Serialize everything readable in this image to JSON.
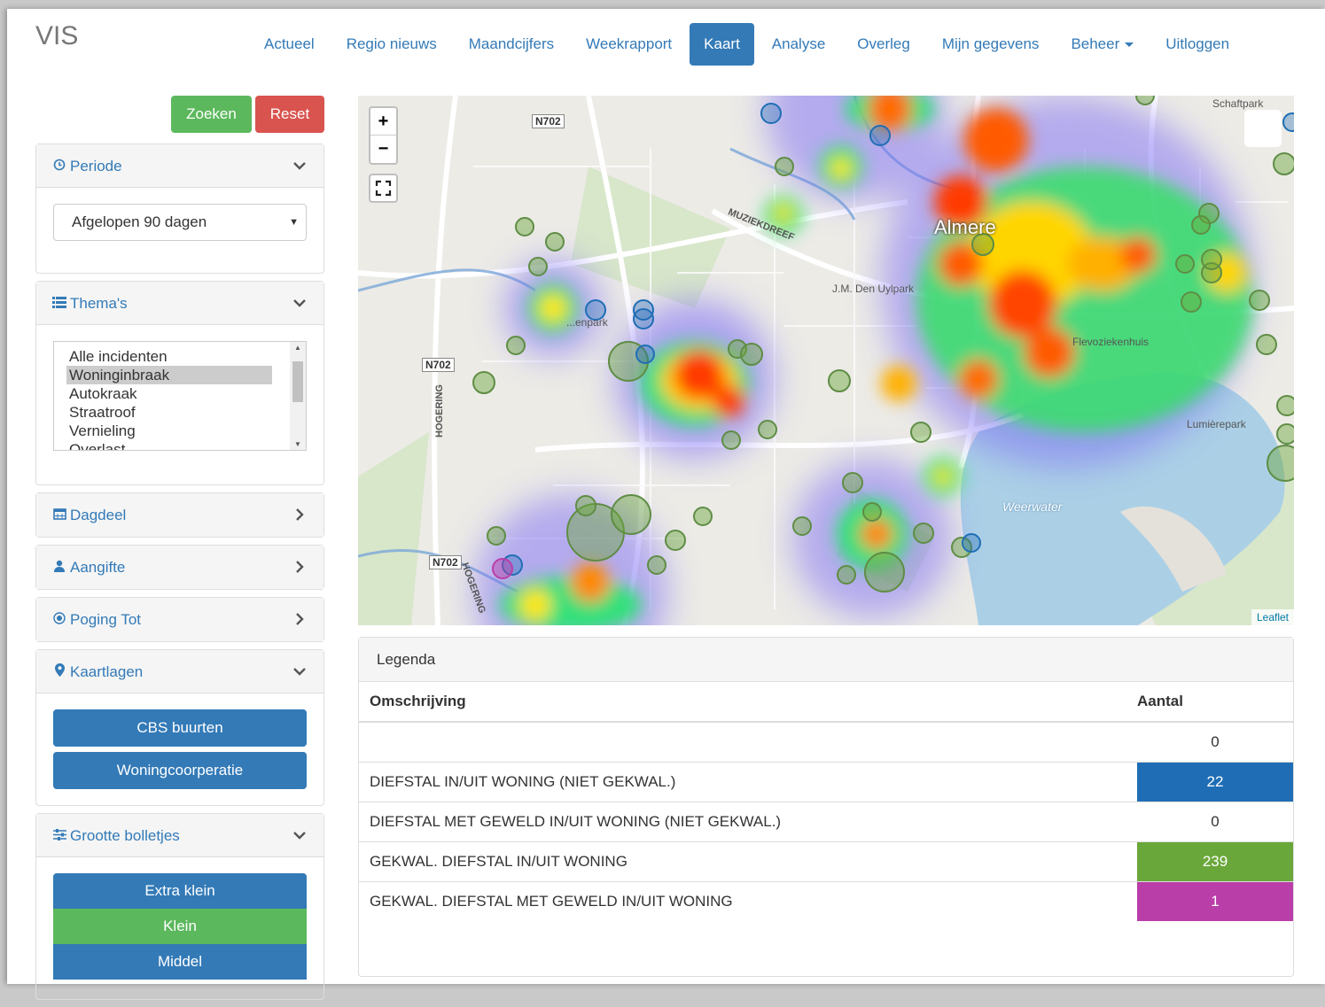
{
  "brand": "VIS",
  "nav": [
    {
      "label": "Actueel"
    },
    {
      "label": "Regio nieuws"
    },
    {
      "label": "Maandcijfers"
    },
    {
      "label": "Weekrapport"
    },
    {
      "label": "Kaart",
      "active": true
    },
    {
      "label": "Analyse"
    },
    {
      "label": "Overleg"
    },
    {
      "label": "Mijn gegevens"
    },
    {
      "label": "Beheer",
      "dropdown": true
    },
    {
      "label": "Uitloggen"
    }
  ],
  "sidebar": {
    "search_label": "Zoeken",
    "reset_label": "Reset",
    "periode": {
      "title": "Periode",
      "icon": "clock-icon",
      "select_value": "Afgelopen 90 dagen"
    },
    "themas": {
      "title": "Thema's",
      "icon": "list-icon",
      "options": [
        "Alle incidenten",
        "Woninginbraak",
        "Autokraak",
        "Straatroof",
        "Vernieling",
        "Overlast"
      ],
      "selected": "Woninginbraak"
    },
    "dagdeel": {
      "title": "Dagdeel",
      "icon": "calendar-icon"
    },
    "aangifte": {
      "title": "Aangifte",
      "icon": "user-icon"
    },
    "poging": {
      "title": "Poging Tot",
      "icon": "target-icon"
    },
    "kaartlagen": {
      "title": "Kaartlagen",
      "icon": "map-marker-icon",
      "buttons": [
        "CBS buurten",
        "Woningcoorperatie"
      ]
    },
    "grootte": {
      "title": "Grootte bolletjes",
      "icon": "sliders-icon",
      "options": [
        "Extra klein",
        "Klein",
        "Middel"
      ],
      "selected": "Klein"
    }
  },
  "map": {
    "zoom_in": "+",
    "zoom_out": "−",
    "attribution": "Leaflet",
    "labels": {
      "city": "Almere",
      "muziekdreef": "MUZIEKDREEF",
      "uylpark": "J.M. Den Uylpark",
      "park_left": "...enpark",
      "ziekenhuis": "Flevoziekenhuis",
      "lumierepark": "Lumièrepark",
      "weerwater": "Weerwater",
      "schaftpark": "Schaftpark",
      "hogering": "HOGERING"
    },
    "road_shield": "N702"
  },
  "legend": {
    "title": "Legenda",
    "col_desc": "Omschrijving",
    "col_count": "Aantal",
    "rows": [
      {
        "desc": "",
        "count": "0",
        "color": ""
      },
      {
        "desc": "DIEFSTAL IN/UIT WONING (NIET GEKWAL.)",
        "count": "22",
        "color": "#1f6eb5"
      },
      {
        "desc": "DIEFSTAL MET GEWELD IN/UIT WONING (NIET GEKWAL.)",
        "count": "0",
        "color": ""
      },
      {
        "desc": "GEKWAL. DIEFSTAL IN/UIT WONING",
        "count": "239",
        "color": "#6aa73a"
      },
      {
        "desc": "GEKWAL. DIEFSTAL MET GEWELD IN/UIT WONING",
        "count": "1",
        "color": "#b93ea8"
      }
    ]
  }
}
